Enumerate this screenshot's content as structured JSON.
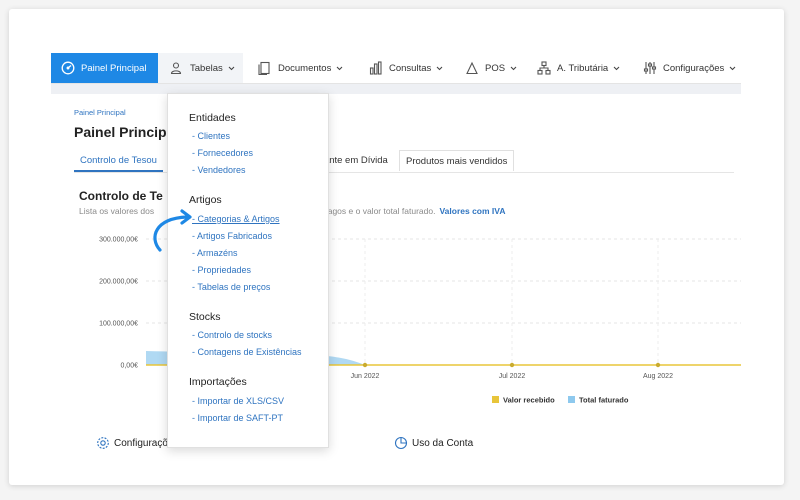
{
  "navbar": {
    "home": "Painel Principal",
    "tabelas": "Tabelas",
    "documentos": "Documentos",
    "consultas": "Consultas",
    "pos": "POS",
    "autoridade": "A. Tributária",
    "configuracoes": "Configurações"
  },
  "page": {
    "breadcrumb": "Painel Principal",
    "title": "Painel Princip",
    "tabs": [
      "Controlo de Tesou",
      "ntante em Dívida",
      "Produtos mais vendidos"
    ],
    "section_title": "Controlo de Te",
    "section_sub": "Lista os valores dos",
    "section_sub_rest": "pagos e o valor total faturado.",
    "iva_link": "Valores com IVA"
  },
  "chart_data": {
    "type": "area",
    "y_tick_labels": [
      "300.000,00€",
      "200.000,00€",
      "100.000,00€",
      "0,00€"
    ],
    "x_tick_labels": [
      "Jun 2022",
      "Jul 2022",
      "Aug 2022"
    ],
    "ylim": [
      0,
      300000
    ],
    "series": [
      {
        "name": "Valor recebido",
        "color": "#e8c53a",
        "values": [
          0,
          0,
          0
        ]
      },
      {
        "name": "Total faturado",
        "color": "#8ec9ee",
        "values": [
          0,
          0,
          0
        ]
      }
    ],
    "legend_position": "bottom-right"
  },
  "dropdown": {
    "sections": [
      {
        "heading": "Entidades",
        "items": [
          "- Clientes",
          "- Fornecedores",
          "- Vendedores"
        ]
      },
      {
        "heading": "Artigos",
        "items": [
          "- Categorias & Artigos",
          "- Artigos Fabricados",
          "- Armazéns",
          "- Propriedades",
          "- Tabelas de preços"
        ]
      },
      {
        "heading": "Stocks",
        "items": [
          "- Controlo de stocks",
          "- Contagens de Existências"
        ]
      },
      {
        "heading": "Importações",
        "items": [
          "- Importar de XLS/CSV",
          "- Importar de SAFT-PT"
        ]
      }
    ]
  },
  "bottom": {
    "config": "Configuraçõ",
    "uso": "Uso da Conta"
  },
  "colors": {
    "accent": "#1e88e5",
    "link": "#2f74c0",
    "arrow": "#1e88e5"
  }
}
